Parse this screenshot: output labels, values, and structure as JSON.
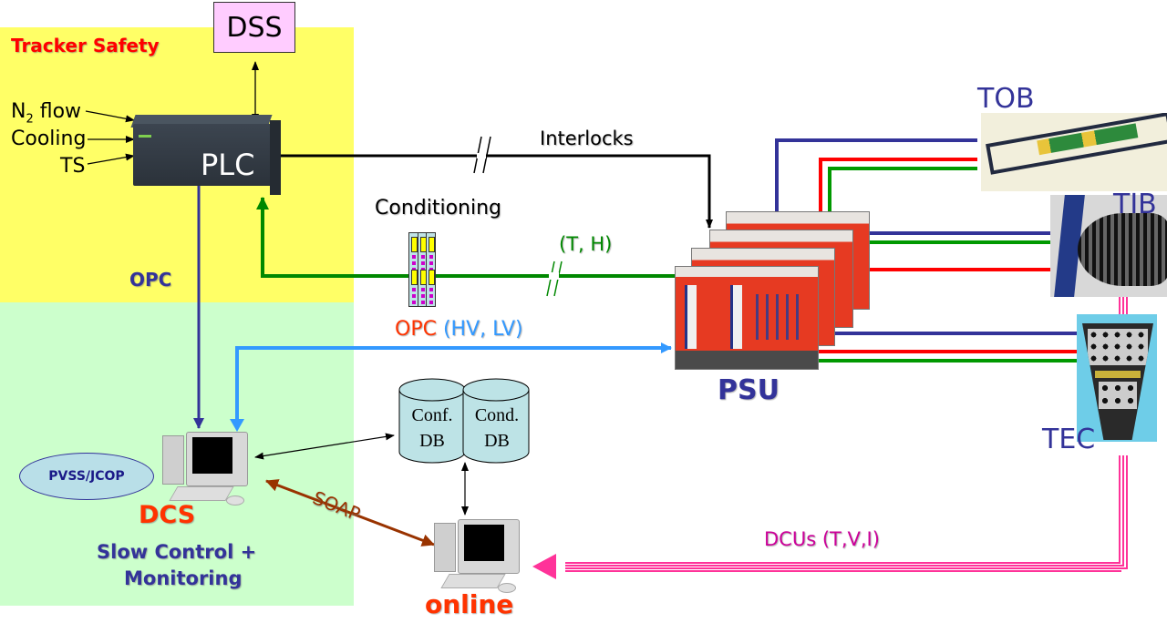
{
  "zones": {
    "tracker_safety": {
      "title": "Tracker Safety",
      "color": "#ffff66",
      "title_color": "#ff0000"
    },
    "dcs_area": {
      "color": "#ccffcc"
    }
  },
  "nodes": {
    "dss": {
      "label": "DSS",
      "fill": "#ffccff"
    },
    "plc": {
      "label": "PLC"
    },
    "inputs": {
      "n2_main": "N",
      "n2_sub": "2",
      "n2_rest": " flow",
      "cooling": "Cooling",
      "ts": "TS"
    },
    "conditioning": {
      "label": "Conditioning"
    },
    "psu": {
      "label": "PSU",
      "color": "#333399"
    },
    "tob": {
      "label": "TOB"
    },
    "tib": {
      "label": "TIB"
    },
    "tec": {
      "label": "TEC"
    },
    "databases": [
      {
        "line1": "Conf.",
        "line2": "DB"
      },
      {
        "line1": "Cond.",
        "line2": "DB"
      }
    ],
    "dcs": {
      "label": "DCS",
      "subtitle_line1": "Slow Control +",
      "subtitle_line2": "Monitoring",
      "software": "PVSS/JCOP"
    },
    "online": {
      "label": "online"
    }
  },
  "links": {
    "interlocks": {
      "label": "Interlocks",
      "color": "#000000"
    },
    "th": {
      "label": "(T, H)",
      "color": "#008800"
    },
    "opc_plc": {
      "label": "OPC",
      "color": "#333399"
    },
    "opc_hvlv": {
      "label_a": "OPC",
      "label_b": " (HV, LV)",
      "color_a": "#ff3300",
      "color_b": "#3399ff"
    },
    "soap": {
      "label": "SOAP",
      "color": "#993300"
    },
    "dcus": {
      "label": "DCUs (T,V,I)",
      "color": "#ff3399",
      "text_color": "#cc0099"
    }
  },
  "cable_colors": {
    "blue": "#333399",
    "red": "#ff0000",
    "green": "#009900"
  }
}
